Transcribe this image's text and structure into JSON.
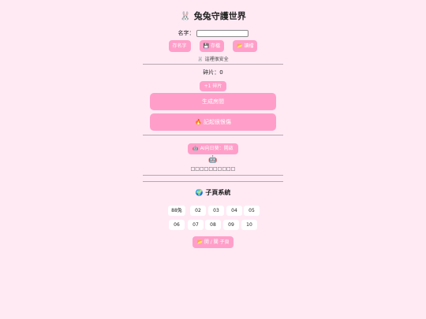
{
  "header": {
    "icon": "🐰",
    "title": "兔兔守護世界"
  },
  "name": {
    "label": "名字：",
    "value": "",
    "placeholder": ""
  },
  "toolbar": {
    "save_name": "存名字",
    "save": "💾 存檔",
    "load": "📂 讀檔"
  },
  "guard_status": "🐰 這裡很安全",
  "fragments": {
    "label": "碎片：0",
    "add_button": "+1 碎片"
  },
  "actions": {
    "generate": "生成房間",
    "remember": "🔥 記起很恨傷"
  },
  "ai": {
    "button": "🤖 AI向日葵：開啟",
    "robot_icon": "🤖",
    "output": "□□□□□□□□□□"
  },
  "subpages": {
    "title": "🌍 子頁系統",
    "row1": [
      "88兔",
      "02",
      "03",
      "04",
      "05"
    ],
    "row2": [
      "06",
      "07",
      "08",
      "09",
      "10"
    ],
    "open_button": "📂 開 / 關 子頁"
  },
  "colors": {
    "background": "#ffeaf4",
    "accent": "#ff9fc9"
  }
}
